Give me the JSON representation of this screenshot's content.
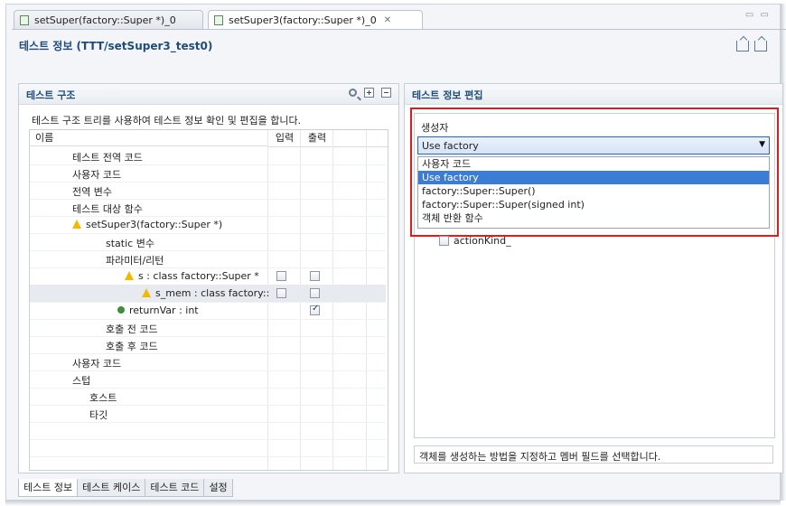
{
  "tabs": [
    {
      "label": "setSuper(factory::Super *)_0"
    },
    {
      "label": "setSuper3(factory::Super *)_0"
    }
  ],
  "window_controls": "▭ ▭",
  "editor_title": "테스트 정보 (TTT/setSuper3_test0)",
  "left_panel": {
    "title": "테스트 구조",
    "description": "테스트 구조 트리를 사용하여 테스트 정보 확인 및 편집을 합니다.",
    "columns": {
      "name": "이름",
      "input": "입력",
      "output": "출력"
    },
    "rows": [
      {
        "label": "테스트 전역 코드"
      },
      {
        "label": "사용자 코드"
      },
      {
        "label": "전역 변수"
      },
      {
        "label": "테스트 대상 함수"
      },
      {
        "label": "setSuper3(factory::Super *)"
      },
      {
        "label": "static 변수"
      },
      {
        "label": "파라미터/리턴"
      },
      {
        "label": "s  :  class factory::Super *"
      },
      {
        "label": "s_mem  :  class factory::"
      },
      {
        "label": "returnVar  :  int"
      },
      {
        "label": "호출 전 코드"
      },
      {
        "label": "호출 후 코드"
      },
      {
        "label": "사용자 코드"
      },
      {
        "label": "스텁"
      },
      {
        "label": "호스트"
      },
      {
        "label": "타깃"
      }
    ]
  },
  "right_panel": {
    "title": "테스트 정보 편집",
    "generator_label": "생성자",
    "combo_value": "Use factory",
    "options": [
      "사용자 코드",
      "Use factory",
      "factory::Super::Super()",
      "factory::Super::Super(signed int)",
      "객체 반환 함수"
    ],
    "selected_option": "Use factory",
    "field_item": "actionKind_",
    "hint": "객체를 생성하는 방법을 지정하고 멤버 필드를 선택합니다."
  },
  "bottom_tabs": [
    "테스트 정보",
    "테스트 케이스",
    "테스트 코드",
    "설정"
  ],
  "colors": {
    "accent": "#1f4d78",
    "highlight": "#e01b1b",
    "selection": "#3b7cd6",
    "warning": "#f5b800"
  }
}
